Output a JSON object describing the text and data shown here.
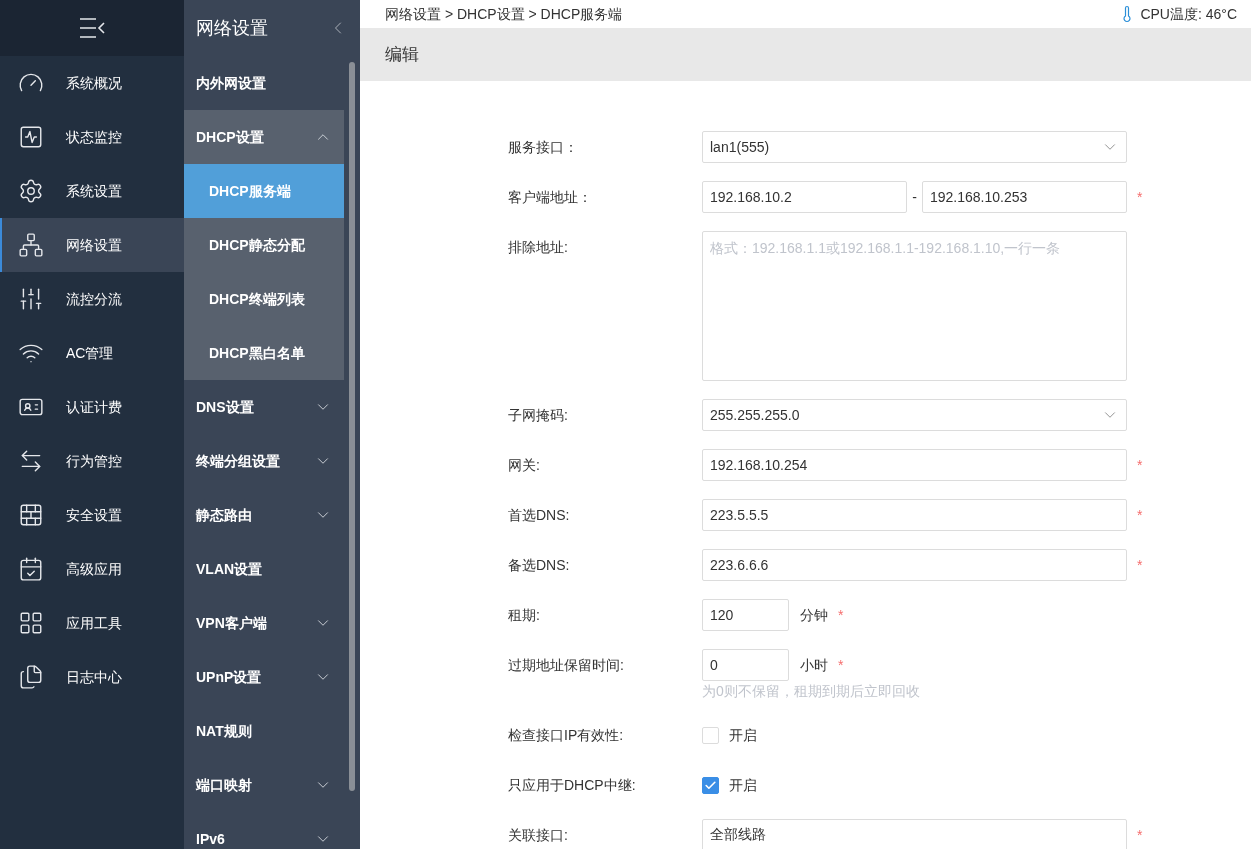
{
  "main_nav": {
    "items": [
      {
        "label": "系统概况",
        "selected": false
      },
      {
        "label": "状态监控",
        "selected": false
      },
      {
        "label": "系统设置",
        "selected": false
      },
      {
        "label": "网络设置",
        "selected": true
      },
      {
        "label": "流控分流",
        "selected": false
      },
      {
        "label": "AC管理",
        "selected": false
      },
      {
        "label": "认证计费",
        "selected": false
      },
      {
        "label": "行为管控",
        "selected": false
      },
      {
        "label": "安全设置",
        "selected": false
      },
      {
        "label": "高级应用",
        "selected": false
      },
      {
        "label": "应用工具",
        "selected": false
      },
      {
        "label": "日志中心",
        "selected": false
      }
    ]
  },
  "sub_nav": {
    "title": "网络设置",
    "items": [
      {
        "label": "内外网设置"
      },
      {
        "label": "DHCP设置",
        "expanded": true,
        "children": [
          {
            "label": "DHCP服务端",
            "selected": true
          },
          {
            "label": "DHCP静态分配",
            "selected": false
          },
          {
            "label": "DHCP终端列表",
            "selected": false
          },
          {
            "label": "DHCP黑白名单",
            "selected": false
          }
        ]
      },
      {
        "label": "DNS设置",
        "expanded": false
      },
      {
        "label": "终端分组设置",
        "expanded": false
      },
      {
        "label": "静态路由",
        "expanded": false
      },
      {
        "label": "VLAN设置"
      },
      {
        "label": "VPN客户端",
        "expanded": false
      },
      {
        "label": "UPnP设置",
        "expanded": false
      },
      {
        "label": "NAT规则"
      },
      {
        "label": "端口映射",
        "expanded": false
      },
      {
        "label": "IPv6",
        "expanded": false
      }
    ]
  },
  "breadcrumb": "网络设置 > DHCP设置 > DHCP服务端",
  "cpu_temperature": "CPU温度: 46°C",
  "section_title": "编辑",
  "form": [
    {
      "kind": "select",
      "label": "服务接口：",
      "value": "lan1(555)"
    },
    {
      "kind": "range",
      "label": "客户端地址：",
      "from": "192.168.10.2",
      "separator": "-",
      "to": "192.168.10.253",
      "mark": "*"
    },
    {
      "kind": "textarea",
      "label": "排除地址:",
      "placeholder": "格式：192.168.1.1或192.168.1.1-192.168.1.10,一行一条"
    },
    {
      "kind": "select",
      "label": "子网掩码:",
      "value": "255.255.255.0"
    },
    {
      "kind": "input",
      "label": "网关:",
      "value": "192.168.10.254",
      "mark": "*"
    },
    {
      "kind": "input",
      "label": "首选DNS:",
      "value": "223.5.5.5",
      "mark": "*"
    },
    {
      "kind": "input",
      "label": "备选DNS:",
      "value": "223.6.6.6",
      "mark": "*"
    },
    {
      "kind": "number",
      "label": "租期:",
      "value": "120",
      "unit": "分钟",
      "mark": "*"
    },
    {
      "kind": "number",
      "label": "过期地址保留时间:",
      "value": "0",
      "unit": "小时",
      "mark": "*",
      "hint": "为0则不保留，租期到期后立即回收"
    },
    {
      "kind": "checkbox",
      "label": "检查接口IP有效性:",
      "option": "开启",
      "checked": false
    },
    {
      "kind": "checkbox",
      "label": "只应用于DHCP中继:",
      "option": "开启",
      "checked": true
    },
    {
      "kind": "input",
      "label": "关联接口:",
      "value": "全部线路",
      "mark": "*"
    }
  ]
}
